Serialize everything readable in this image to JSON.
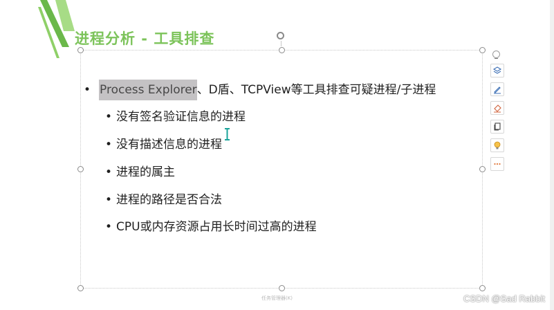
{
  "slide": {
    "title": "进程分析 - 工具排查",
    "main_bullet": {
      "highlighted_text": "Process Explorer",
      "rest_text": "、D盾、TCPView等工具排查可疑进程/子进程"
    },
    "sub_bullets": [
      "没有签名验证信息的进程",
      "没有描述信息的进程",
      "进程的属主",
      "进程的路径是否合法",
      "CPU或内存资源占用长时间过高的进程"
    ],
    "footer_placeholder": "任务管理器(K)",
    "bullet_glyph": "•"
  },
  "toolbar": {
    "buttons": [
      "layers-icon",
      "pen-icon",
      "eraser-icon",
      "copy-icon",
      "bulb-icon",
      "more-icon"
    ]
  },
  "watermark": "CSDN @Sad Rabbit",
  "colors": {
    "title": "#7cc35a",
    "decoration_stripe": "#6bb84a",
    "highlight": "#c4c2c4",
    "cursor": "#1aa39a",
    "more_icon": "#e0773a"
  }
}
